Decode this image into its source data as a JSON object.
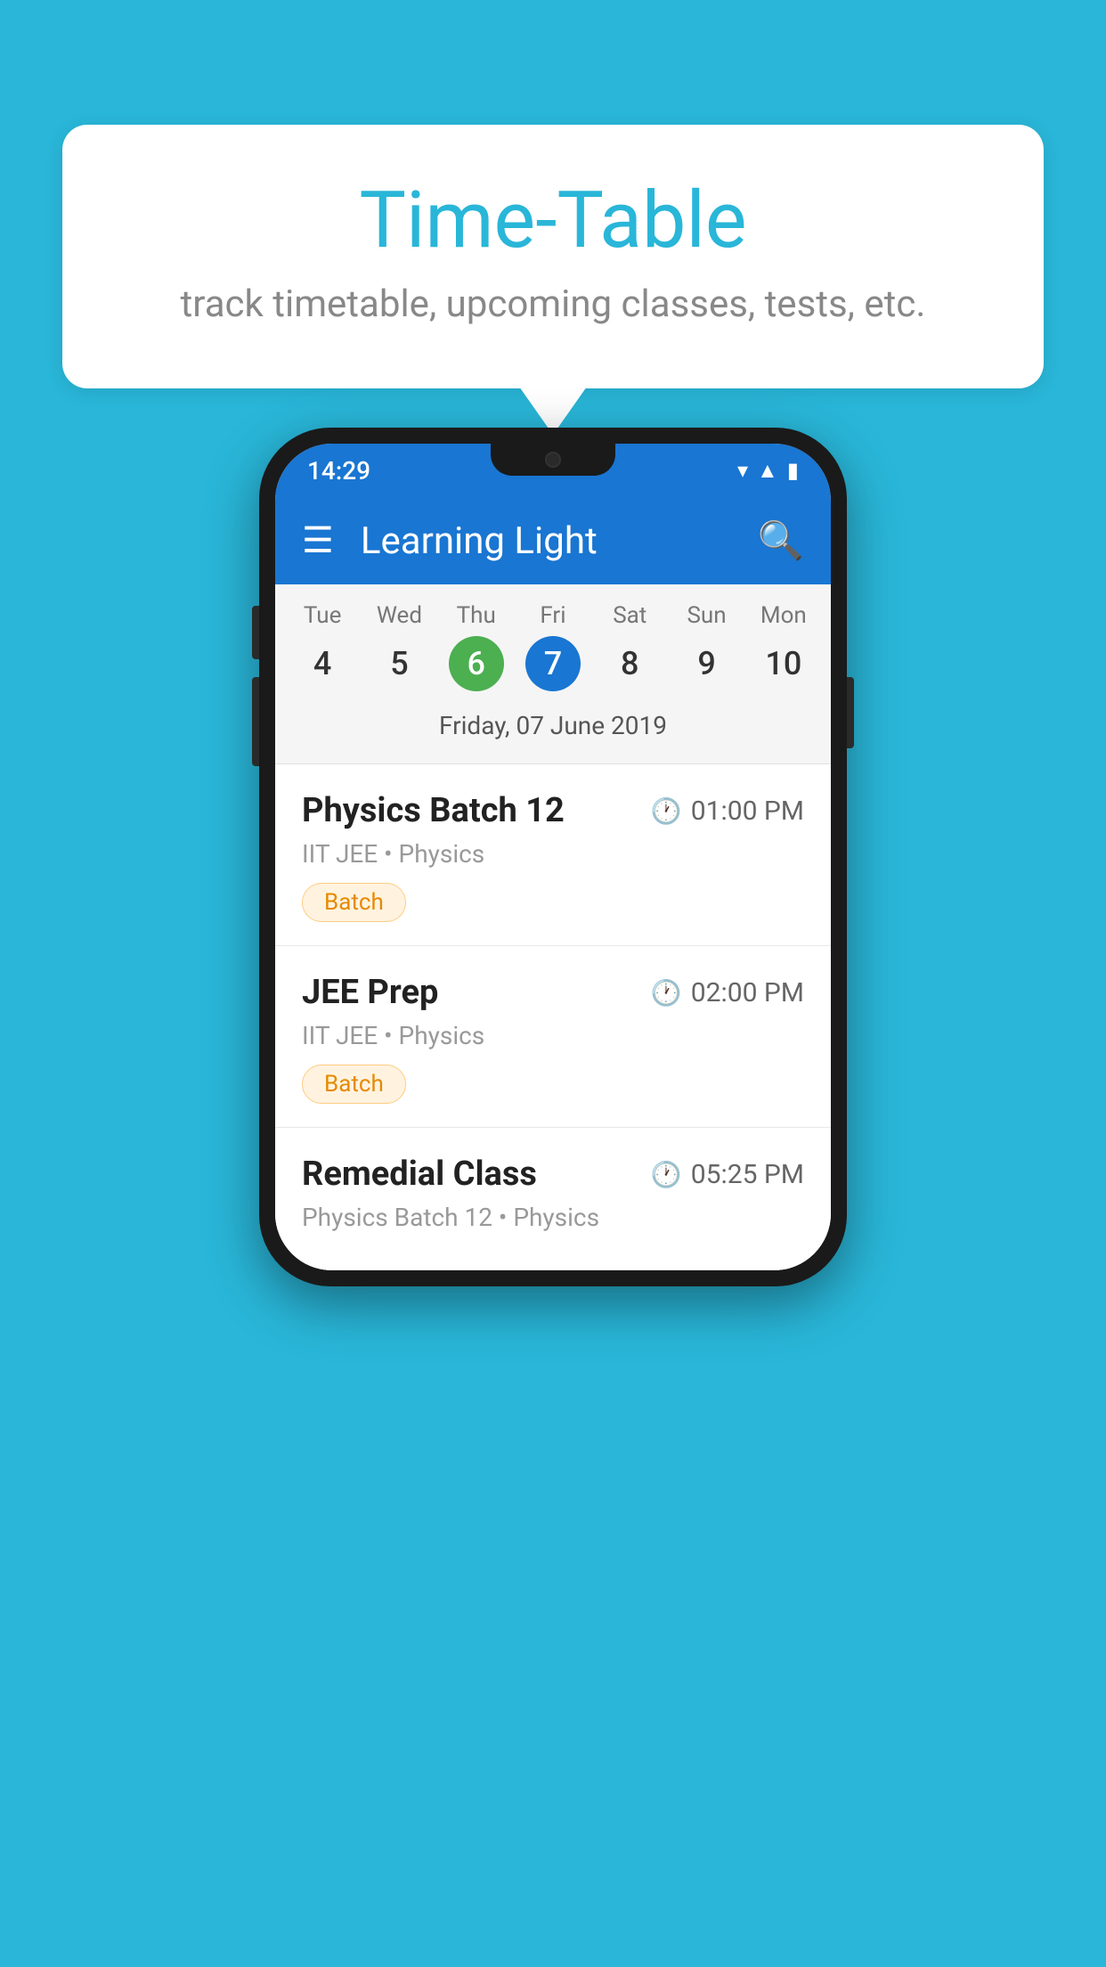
{
  "background_color": "#29b6d8",
  "bubble": {
    "title": "Time-Table",
    "subtitle": "track timetable, upcoming classes, tests, etc."
  },
  "phone": {
    "status_bar": {
      "time": "14:29"
    },
    "app_bar": {
      "title": "Learning Light"
    },
    "calendar": {
      "days": [
        {
          "label": "Tue",
          "number": "4",
          "state": "normal"
        },
        {
          "label": "Wed",
          "number": "5",
          "state": "normal"
        },
        {
          "label": "Thu",
          "number": "6",
          "state": "today"
        },
        {
          "label": "Fri",
          "number": "7",
          "state": "selected"
        },
        {
          "label": "Sat",
          "number": "8",
          "state": "normal"
        },
        {
          "label": "Sun",
          "number": "9",
          "state": "normal"
        },
        {
          "label": "Mon",
          "number": "10",
          "state": "normal"
        }
      ],
      "selected_date": "Friday, 07 June 2019"
    },
    "schedule": [
      {
        "title": "Physics Batch 12",
        "time": "01:00 PM",
        "subtitle": "IIT JEE • Physics",
        "tag": "Batch"
      },
      {
        "title": "JEE Prep",
        "time": "02:00 PM",
        "subtitle": "IIT JEE • Physics",
        "tag": "Batch"
      },
      {
        "title": "Remedial Class",
        "time": "05:25 PM",
        "subtitle": "Physics Batch 12 • Physics",
        "tag": null
      }
    ]
  }
}
